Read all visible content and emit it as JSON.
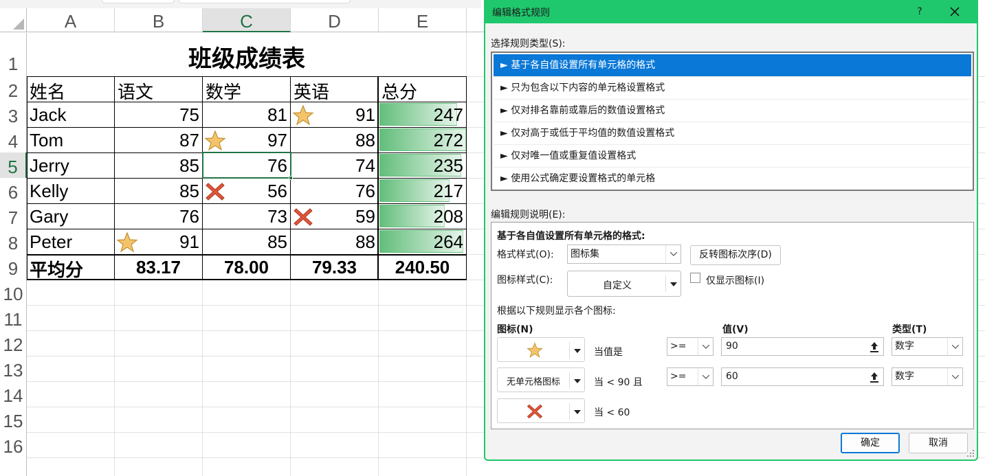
{
  "sheet": {
    "columns": [
      "A",
      "B",
      "C",
      "D",
      "E"
    ],
    "selected_column": "C",
    "rows": [
      "1",
      "2",
      "3",
      "4",
      "5",
      "6",
      "7",
      "8",
      "9",
      "10",
      "11",
      "12",
      "13",
      "14",
      "15",
      "16"
    ],
    "selected_row": "5",
    "title": "班级成绩表",
    "headers": [
      "姓名",
      "语文",
      "数学",
      "英语",
      "总分"
    ],
    "students": [
      {
        "name": "Jack",
        "chinese": "75",
        "math": "81",
        "english": "91",
        "total": "247"
      },
      {
        "name": "Tom",
        "chinese": "87",
        "math": "97",
        "english": "88",
        "total": "272"
      },
      {
        "name": "Jerry",
        "chinese": "85",
        "math": "76",
        "english": "74",
        "total": "235"
      },
      {
        "name": "Kelly",
        "chinese": "85",
        "math": "56",
        "english": "76",
        "total": "217"
      },
      {
        "name": "Gary",
        "chinese": "76",
        "math": "73",
        "english": "59",
        "total": "208"
      },
      {
        "name": "Peter",
        "chinese": "91",
        "math": "85",
        "english": "88",
        "total": "264"
      }
    ],
    "average": {
      "label": "平均分",
      "chinese": "83.17",
      "math": "78.00",
      "english": "79.33",
      "total": "240.50"
    },
    "cell_icons": [
      {
        "row": 0,
        "col": "english",
        "icon": "star-icon"
      },
      {
        "row": 1,
        "col": "math",
        "icon": "star-icon"
      },
      {
        "row": 3,
        "col": "math",
        "icon": "red-x-icon"
      },
      {
        "row": 4,
        "col": "english",
        "icon": "red-x-icon"
      },
      {
        "row": 5,
        "col": "chinese",
        "icon": "star-icon"
      }
    ],
    "total_bar_fraction": [
      0.88,
      0.985,
      0.93,
      0.8,
      0.74,
      0.96
    ],
    "colors": {
      "accent": "#217346",
      "databar": "#63be7b",
      "star": "#f3c46b",
      "cross": "#e0553a"
    }
  },
  "dialog": {
    "title": "编辑格式规则",
    "help": "?",
    "rule_type_label": "选择规则类型(S):",
    "rule_types": [
      "► 基于各自值设置所有单元格的格式",
      "► 只为包含以下内容的单元格设置格式",
      "► 仅对排名靠前或靠后的数值设置格式",
      "► 仅对高于或低于平均值的数值设置格式",
      "► 仅对唯一值或重复值设置格式",
      "► 使用公式确定要设置格式的单元格"
    ],
    "selected_rule_index": 0,
    "edit_desc_label": "编辑规则说明(E):",
    "desc_heading": "基于各自值设置所有单元格的格式:",
    "format_style_label": "格式样式(O):",
    "format_style_value": "图标集",
    "reverse_button": "反转图标次序(D)",
    "icon_style_label": "图标样式(C):",
    "icon_style_value": "自定义",
    "show_icon_only_label": "仅显示图标(I)",
    "rules_caption": "根据以下规则显示各个图标:",
    "col_icon": "图标(N)",
    "col_value": "值(V)",
    "col_type": "类型(T)",
    "icon_rules": [
      {
        "icon": "star-icon",
        "icon_text": "",
        "condition": "当值是",
        "operator": ">=",
        "value": "90",
        "type": "数字"
      },
      {
        "icon": "none",
        "icon_text": "无单元格图标",
        "condition": "当 < 90 且",
        "operator": ">=",
        "value": "60",
        "type": "数字"
      },
      {
        "icon": "red-x-icon",
        "icon_text": "",
        "condition": "当 < 60"
      }
    ],
    "ok_button": "确定",
    "cancel_button": "取消",
    "colors": {
      "title_bar": "#1fc86d",
      "selection": "#0a78d7"
    }
  }
}
